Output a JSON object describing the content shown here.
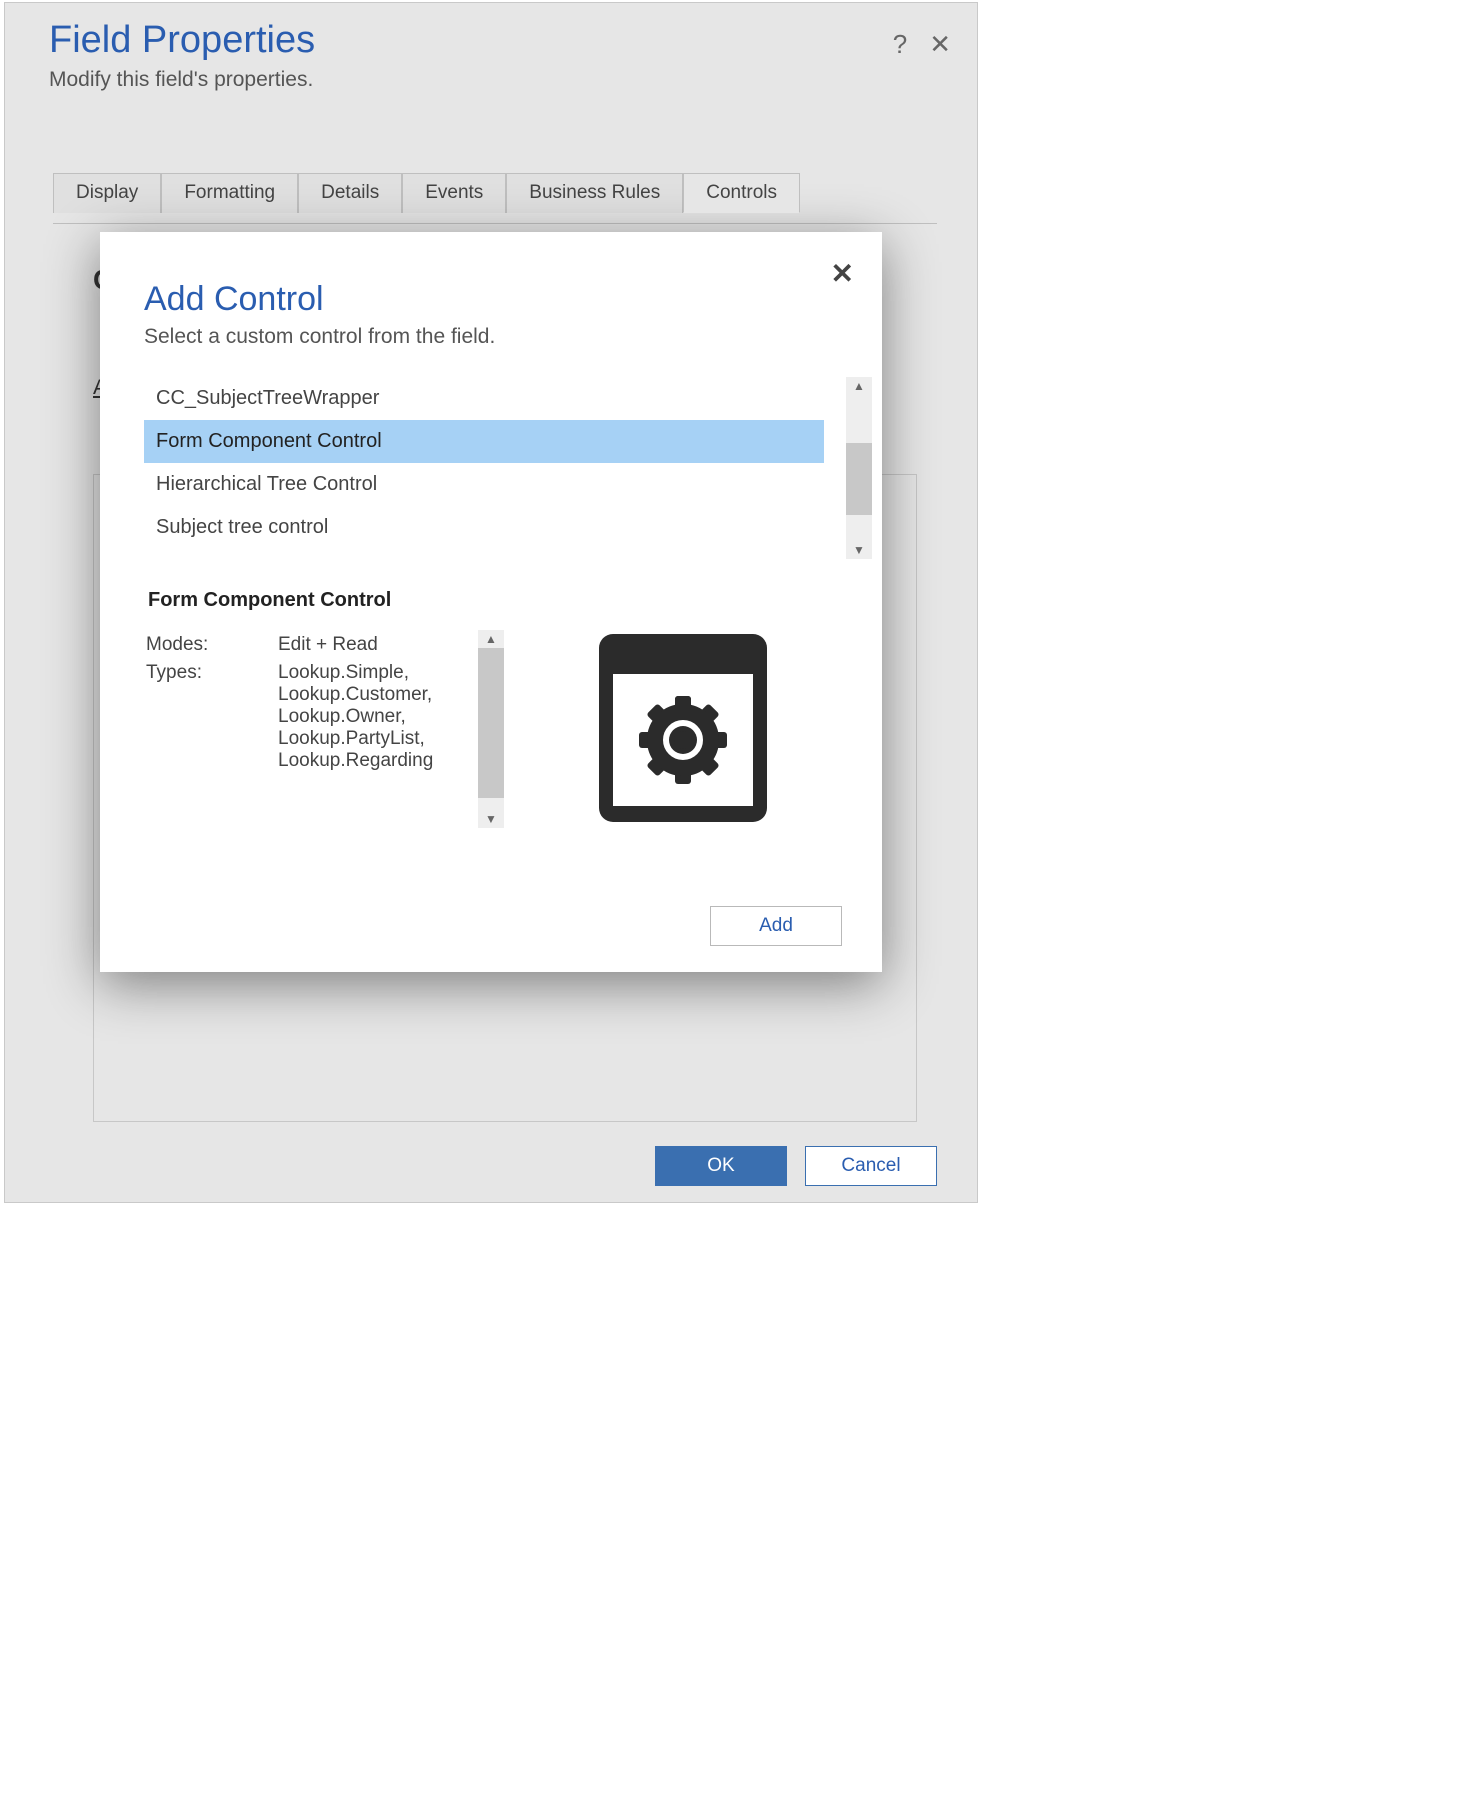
{
  "fieldProperties": {
    "title": "Field Properties",
    "subtitle": "Modify this field's properties.",
    "tabs": [
      "Display",
      "Formatting",
      "Details",
      "Events",
      "Business Rules",
      "Controls"
    ],
    "activeTab": 5,
    "placeholderTop": "C",
    "placeholderLink": "A",
    "buttons": {
      "ok": "OK",
      "cancel": "Cancel"
    }
  },
  "addControl": {
    "title": "Add Control",
    "subtitle": "Select a custom control from the field.",
    "controls": [
      "CC_SubjectTreeWrapper",
      "Form Component Control",
      "Hierarchical Tree Control",
      "Subject tree control"
    ],
    "selectedIndex": 1,
    "detailTitle": "Form Component Control",
    "modesLabel": "Modes:",
    "modesValue": "Edit + Read",
    "typesLabel": "Types:",
    "typesValue": "Lookup.Simple, Lookup.Customer, Lookup.Owner, Lookup.PartyList, Lookup.Regarding",
    "addButton": "Add"
  }
}
